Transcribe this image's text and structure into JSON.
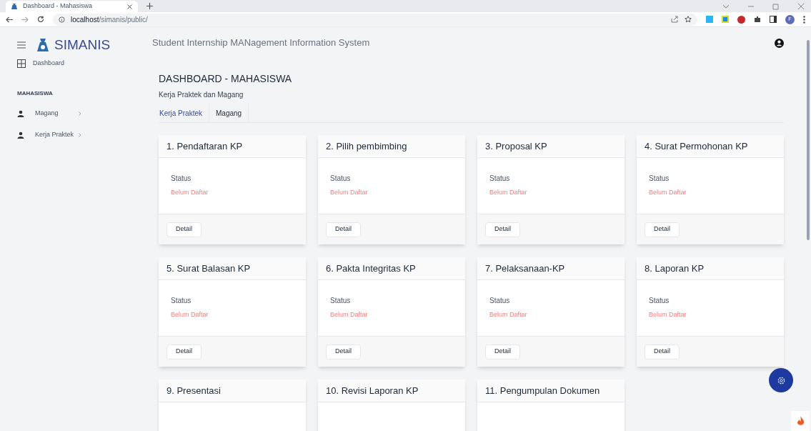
{
  "browser": {
    "tab_title": "Dashboard - Mahasiswa",
    "url_host": "localhost",
    "url_path": "/simanis/public/",
    "profile_initial": "F"
  },
  "app": {
    "logo": "SIMANIS",
    "tagline": "Student Internship MANagement Information System"
  },
  "sidebar": {
    "items": [
      {
        "kind": "link",
        "label": "Dashboard"
      },
      {
        "kind": "heading",
        "label": "MAHASISWA"
      },
      {
        "kind": "menu",
        "label": "Magang",
        "expanded": false
      },
      {
        "kind": "menu",
        "label": "Kerja Praktek",
        "expanded": false
      }
    ]
  },
  "page": {
    "title": "DASHBOARD - MAHASISWA",
    "subtitle": "Kerja Praktek dan Magang"
  },
  "tabs": [
    {
      "label": "Kerja Praktek",
      "selected": true
    },
    {
      "label": "Magang",
      "selected": false
    }
  ],
  "cards": [
    {
      "title": "1. Pendaftaran KP",
      "status_label": "Status",
      "status": "Belum Daftar",
      "button": "Detail"
    },
    {
      "title": "2. Pilih pembimbing",
      "status_label": "Status",
      "status": "Belum Daftar",
      "button": "Detail"
    },
    {
      "title": "3. Proposal KP",
      "status_label": "Status",
      "status": "Belum Daftar",
      "button": "Detail"
    },
    {
      "title": "4. Surat Permohonan KP",
      "status_label": "Status",
      "status": "Belum Daftar",
      "button": "Detail"
    },
    {
      "title": "5. Surat Balasan KP",
      "status_label": "Status",
      "status": "Belum Daftar",
      "button": "Detail"
    },
    {
      "title": "6. Pakta Integritas KP",
      "status_label": "Status",
      "status": "Belum Daftar",
      "button": "Detail"
    },
    {
      "title": "7. Pelaksanaan-KP",
      "status_label": "Status",
      "status": "Belum Daftar",
      "button": "Detail"
    },
    {
      "title": "8. Laporan KP",
      "status_label": "Status",
      "status": "Belum Daftar",
      "button": "Detail"
    },
    {
      "title": "9. Presentasi"
    },
    {
      "title": "10. Revisi Laporan KP"
    },
    {
      "title": "11. Pengumpulan Dokumen"
    }
  ]
}
